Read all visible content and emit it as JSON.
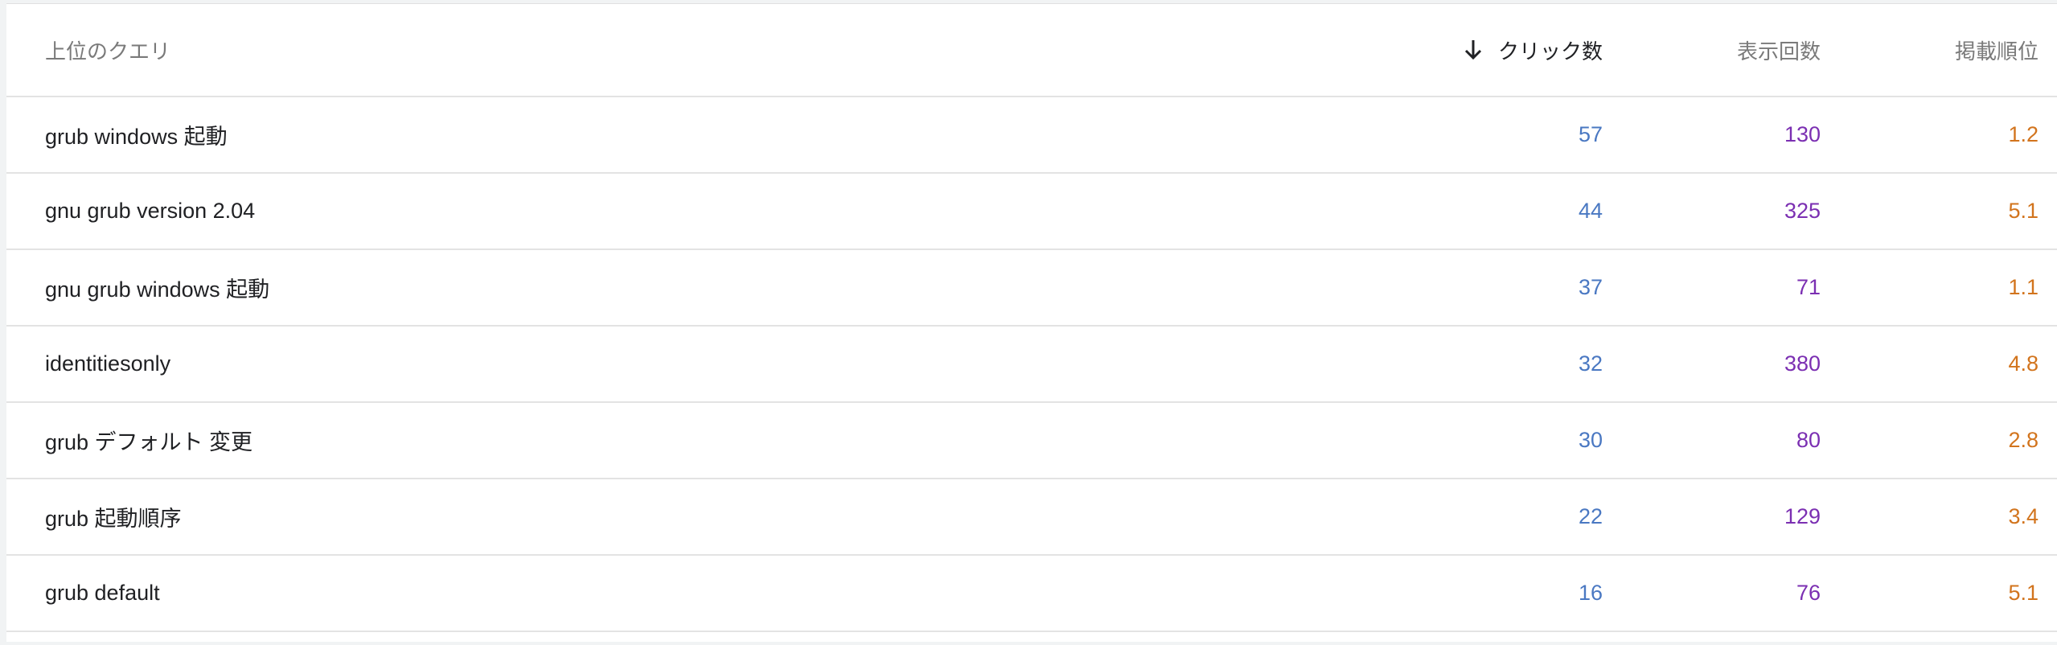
{
  "table": {
    "headers": {
      "query": "上位のクエリ",
      "clicks": "クリック数",
      "impressions": "表示回数",
      "position": "掲載順位"
    },
    "sort_icon": "arrow-down-icon",
    "colors": {
      "clicks": "#4a78c2",
      "impressions": "#7b2fb2",
      "position": "#d2741d"
    },
    "rows": [
      {
        "query": "grub windows 起動",
        "clicks": "57",
        "impressions": "130",
        "position": "1.2"
      },
      {
        "query": "gnu grub version 2.04",
        "clicks": "44",
        "impressions": "325",
        "position": "5.1"
      },
      {
        "query": "gnu grub windows 起動",
        "clicks": "37",
        "impressions": "71",
        "position": "1.1"
      },
      {
        "query": "identitiesonly",
        "clicks": "32",
        "impressions": "380",
        "position": "4.8"
      },
      {
        "query": "grub デフォルト 変更",
        "clicks": "30",
        "impressions": "80",
        "position": "2.8"
      },
      {
        "query": "grub 起動順序",
        "clicks": "22",
        "impressions": "129",
        "position": "3.4"
      },
      {
        "query": "grub default",
        "clicks": "16",
        "impressions": "76",
        "position": "5.1"
      }
    ]
  }
}
